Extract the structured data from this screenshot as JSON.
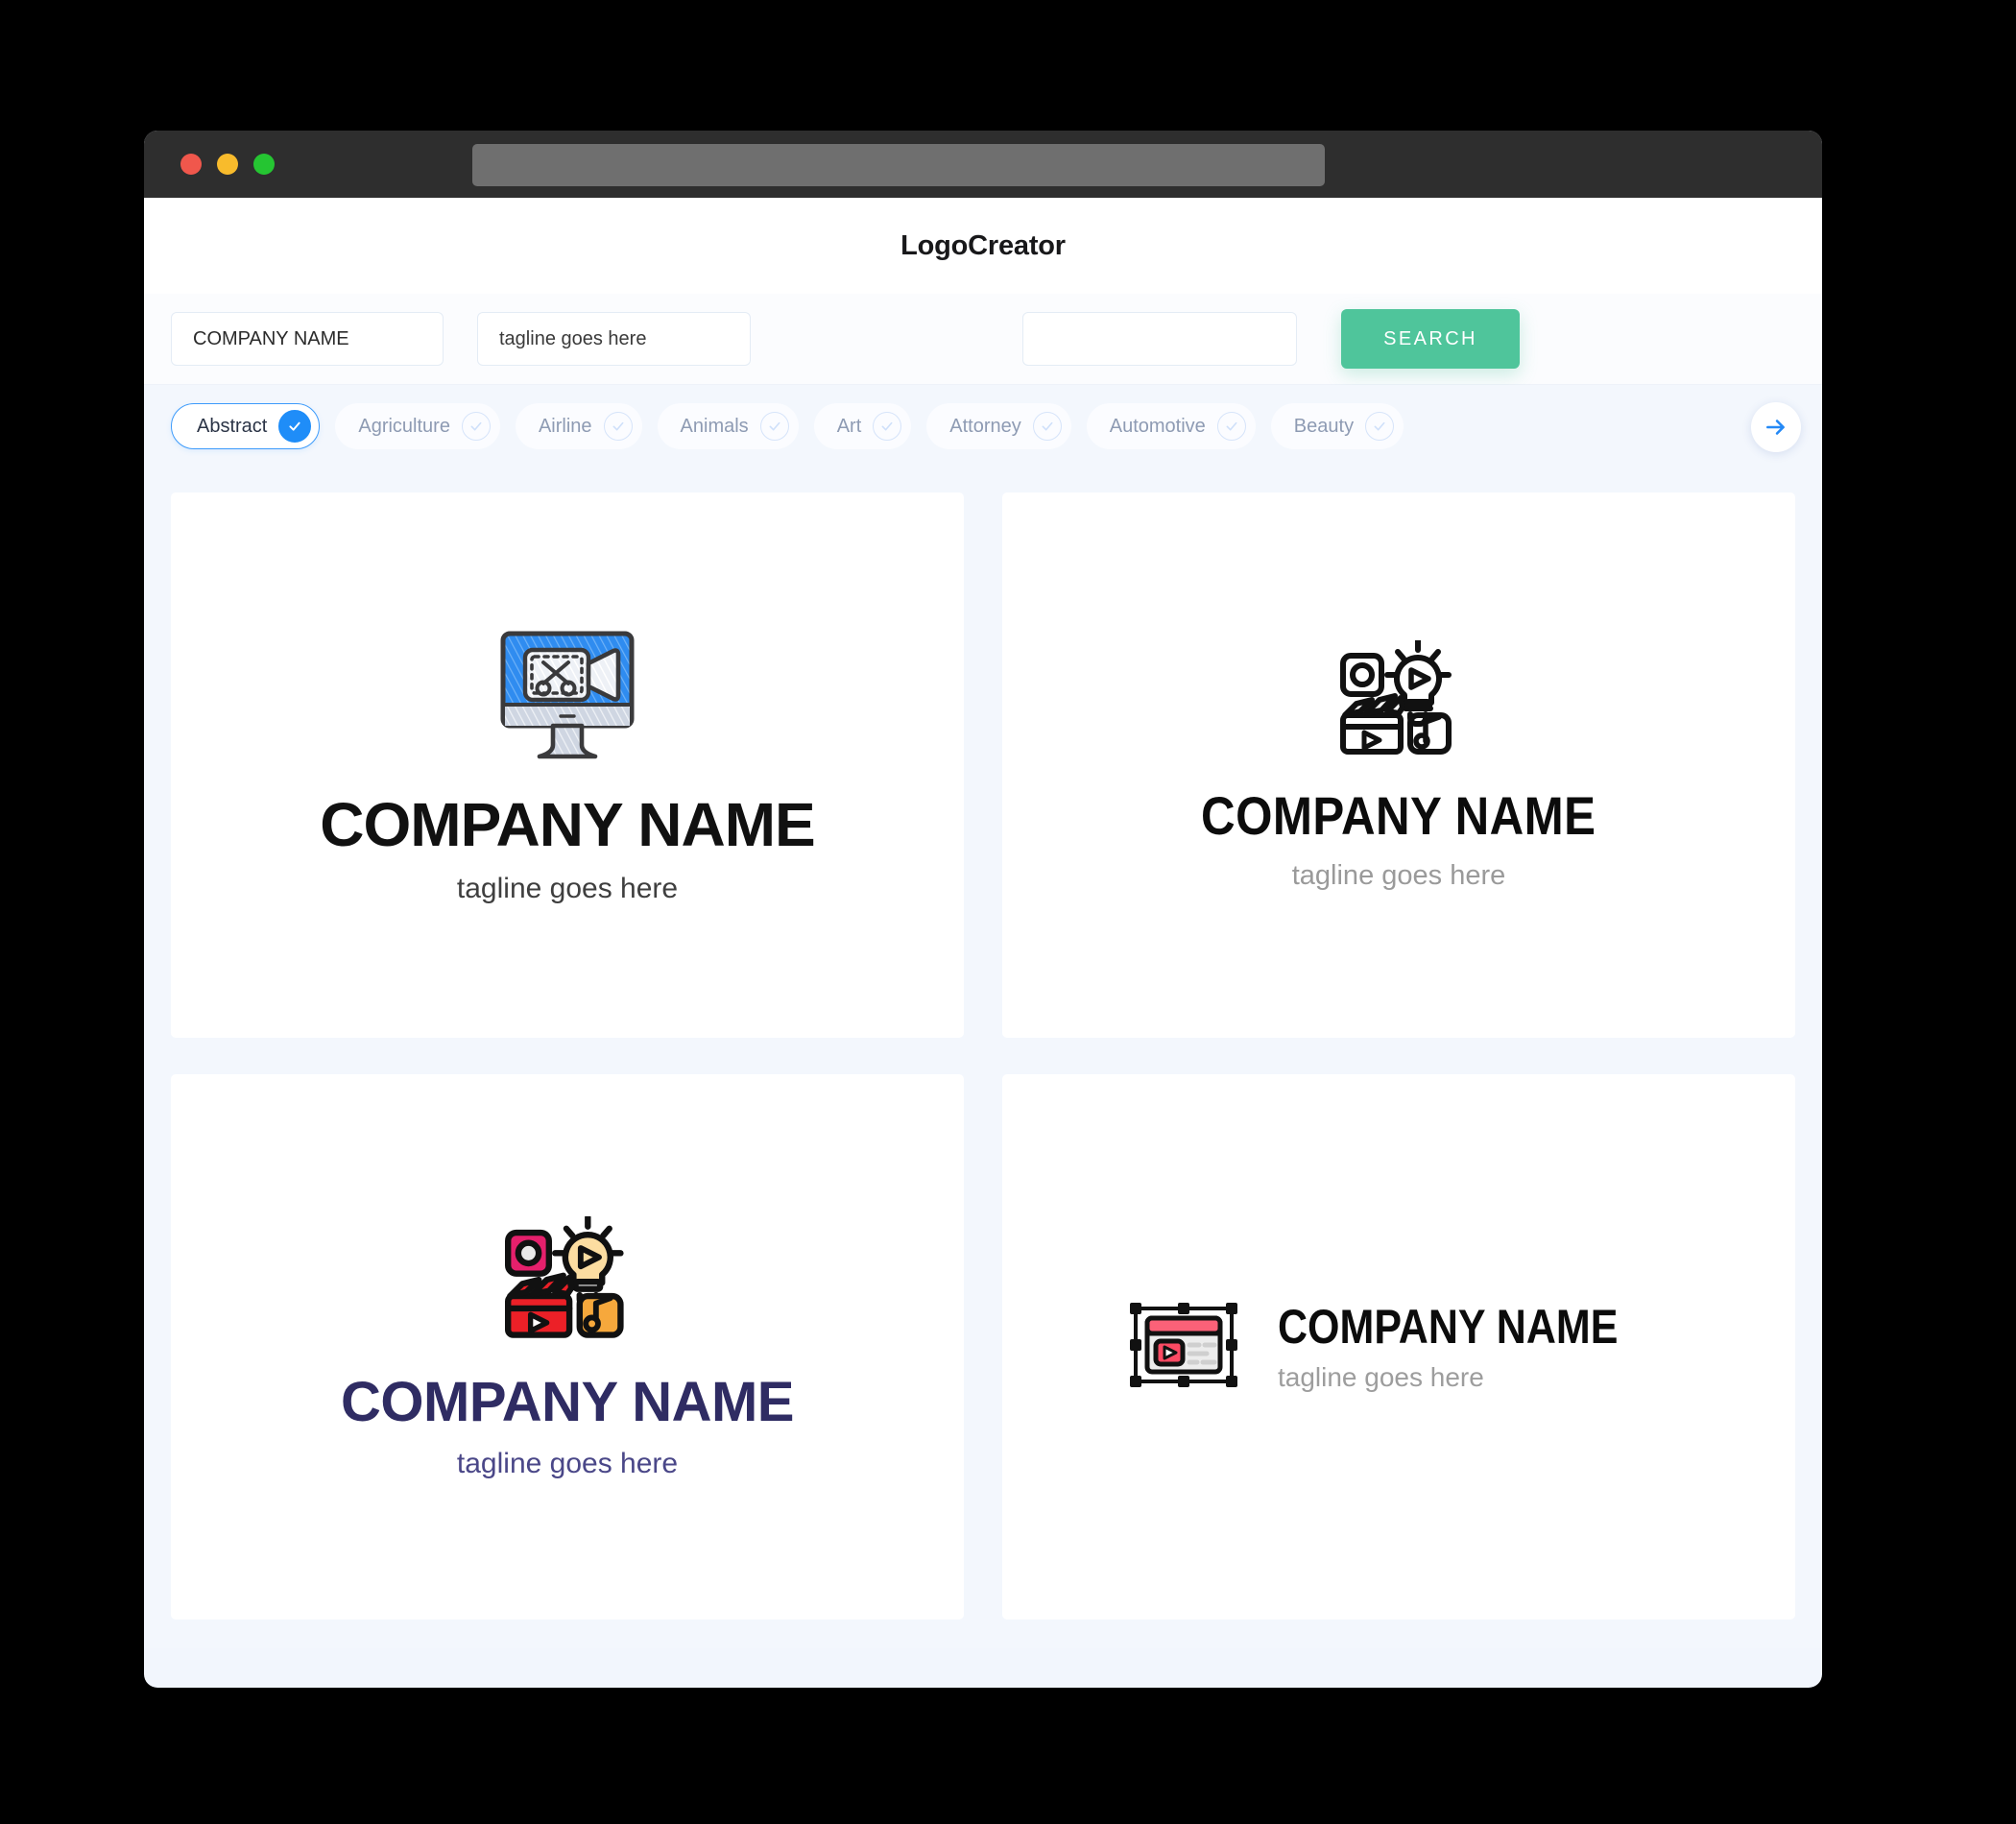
{
  "window": {
    "traffic_lights": [
      "close",
      "minimize",
      "maximize"
    ],
    "url_value": ""
  },
  "header": {
    "brand": "LogoCreator"
  },
  "search": {
    "company_value": "COMPANY NAME",
    "company_placeholder": "COMPANY NAME",
    "tagline_value": "tagline goes here",
    "tagline_placeholder": "tagline goes here",
    "extra_value": "",
    "extra_placeholder": "",
    "button_label": "SEARCH"
  },
  "categories": {
    "next_icon": "arrow-right-icon",
    "items": [
      {
        "label": "Abstract",
        "selected": true
      },
      {
        "label": "Agriculture",
        "selected": false
      },
      {
        "label": "Airline",
        "selected": false
      },
      {
        "label": "Animals",
        "selected": false
      },
      {
        "label": "Art",
        "selected": false
      },
      {
        "label": "Attorney",
        "selected": false
      },
      {
        "label": "Automotive",
        "selected": false
      },
      {
        "label": "Beauty",
        "selected": false
      }
    ]
  },
  "results": [
    {
      "id": "logo-1",
      "icon": "monitor-video-editing-icon",
      "name": "COMPANY NAME",
      "tagline": "tagline goes here",
      "name_color": "#111111",
      "tagline_color": "#3f3f3f",
      "accent_color": "#2f8cf0"
    },
    {
      "id": "logo-2",
      "icon": "media-production-outline-icon",
      "name": "COMPANY NAME",
      "tagline": "tagline goes here",
      "name_color": "#0c0c0c",
      "tagline_color": "#9a9a9a",
      "accent_color": "#000000"
    },
    {
      "id": "logo-3",
      "icon": "media-production-color-icon",
      "name": "COMPANY NAME",
      "tagline": "tagline goes here",
      "name_color": "#2f2c63",
      "tagline_color": "#4a4788",
      "accent_color": "#ec2027"
    },
    {
      "id": "logo-4",
      "icon": "video-window-selection-icon",
      "name": "COMPANY NAME",
      "tagline": "tagline goes here",
      "name_color": "#0c0c0c",
      "tagline_color": "#9d9d9d",
      "accent_color": "#fb4a63"
    }
  ],
  "colors": {
    "page_bg": "#f3f7fd",
    "card_bg": "#ffffff",
    "titlebar": "#2e2e2e",
    "search_button": "#4fc59b",
    "chip_active_border": "#3d9bfb",
    "chip_active_check": "#1f8df8",
    "light_red": "#f0574c",
    "light_yellow": "#f8bb2c",
    "light_green": "#25c532"
  }
}
